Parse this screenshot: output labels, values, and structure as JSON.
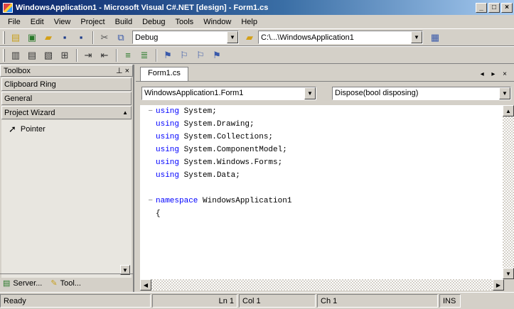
{
  "window": {
    "title": "WindowsApplication1 - Microsoft Visual C#.NET [design] - Form1.cs",
    "min": "_",
    "max": "□",
    "close": "×"
  },
  "menu": [
    "File",
    "Edit",
    "View",
    "Project",
    "Build",
    "Debug",
    "Tools",
    "Window",
    "Help"
  ],
  "toolbar": {
    "config": "Debug",
    "find": "C:\\...\\WindowsApplication1"
  },
  "toolbox": {
    "title": "Toolbox",
    "pin": "⊥ ×",
    "tabs": [
      "Clipboard Ring",
      "General",
      "Project Wizard"
    ],
    "items": [
      "Pointer"
    ],
    "bottom_tabs": [
      "Server...",
      "Tool..."
    ]
  },
  "editor": {
    "doc_tab": "Form1.cs",
    "doc_ctrls": "◂ ▸ ×",
    "type_combo": "WindowsApplication1.Form1",
    "member_combo": "Dispose(bool disposing)",
    "lines": [
      {
        "g": "−",
        "kw": "using",
        "rest": " System;"
      },
      {
        "g": "",
        "kw": "using",
        "rest": " System.Drawing;"
      },
      {
        "g": "",
        "kw": "using",
        "rest": " System.Collections;"
      },
      {
        "g": "",
        "kw": "using",
        "rest": " System.ComponentModel;"
      },
      {
        "g": "",
        "kw": "using",
        "rest": " System.Windows.Forms;"
      },
      {
        "g": "",
        "kw": "using",
        "rest": " System.Data;"
      },
      {
        "g": "",
        "kw": "",
        "rest": ""
      },
      {
        "g": "−",
        "kw": "namespace",
        "rest": " WindowsApplication1"
      },
      {
        "g": "",
        "kw": "",
        "rest": "{"
      }
    ]
  },
  "status": {
    "ready": "Ready",
    "ln": "Ln 1",
    "col": "Col 1",
    "ch": "Ch 1",
    "ins": "INS"
  }
}
